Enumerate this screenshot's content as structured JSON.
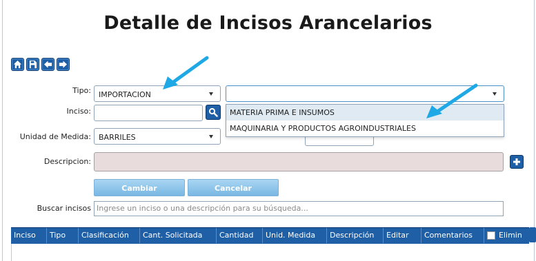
{
  "page": {
    "title": "Detalle de Incisos Arancelarios"
  },
  "toolbar": {
    "icons": [
      "home-icon",
      "save-icon",
      "arrow-left-icon",
      "arrow-right-icon"
    ]
  },
  "form": {
    "tipo_label": "Tipo:",
    "tipo_value": "IMPORTACION",
    "clasificacion_value": "",
    "inciso_label": "Inciso:",
    "inciso_value": "",
    "unidad_label": "Unidad de Medida:",
    "unidad_value": "BARRILES",
    "descripcion_label": "Descripcion:",
    "descripcion_value": ""
  },
  "dropdown": {
    "options": [
      "MATERIA PRIMA E INSUMOS",
      "MAQUINARIA Y PRODUCTOS AGROINDUSTRIALES"
    ]
  },
  "actions": {
    "cambiar": "Cambiar",
    "cancelar": "Cancelar"
  },
  "search": {
    "label": "Buscar incisos",
    "placeholder": "Ingrese un inciso o una descripción para su búsqueda..."
  },
  "table": {
    "columns": [
      "Inciso",
      "Tipo",
      "Clasificación",
      "Cant. Solicitada",
      "Cantidad",
      "Unid. Medida",
      "Descripción",
      "Editar",
      "Comentarios",
      "Elimin"
    ]
  },
  "colors": {
    "accent": "#1f5fa6",
    "button": "#79b7e3",
    "annotation_arrow": "#1ea8e6"
  }
}
